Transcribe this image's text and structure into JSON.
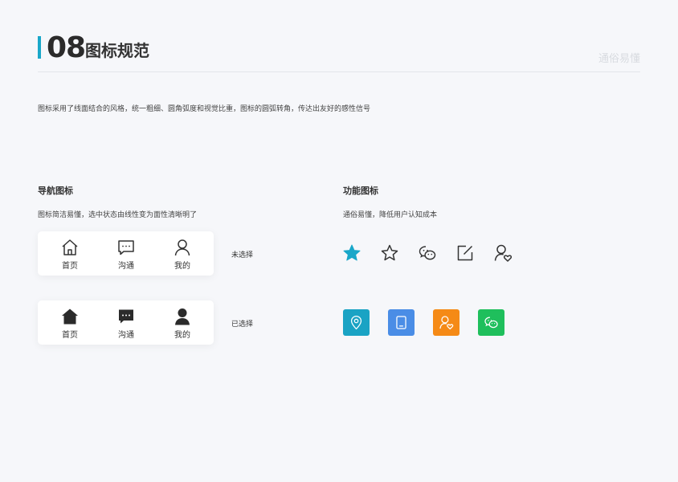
{
  "header": {
    "number": "08",
    "title": "图标规范",
    "motto": "通俗易懂",
    "accent_color": "#19a7c9"
  },
  "description": "图标采用了线面结合的风格，统一粗细、圆角弧度和视觉比重，图标的圆弧转角，传达出友好的感性信号",
  "nav_section": {
    "title": "导航图标",
    "subtitle": "图标简洁易懂，选中状态由线性变为面性清晰明了",
    "items": [
      {
        "label": "首页",
        "icon": "home-icon"
      },
      {
        "label": "沟通",
        "icon": "chat-icon"
      },
      {
        "label": "我的",
        "icon": "user-icon"
      }
    ],
    "unselected_label": "未选择",
    "selected_label": "已选择"
  },
  "func_section": {
    "title": "功能图标",
    "subtitle": "通俗易懂，降低用户认知成本",
    "outline_icons": [
      "star-filled-icon",
      "star-outline-icon",
      "wechat-icon",
      "edit-icon",
      "user-heart-icon"
    ],
    "tiles": [
      {
        "icon": "location-icon",
        "color": "#1aa3c4"
      },
      {
        "icon": "tablet-icon",
        "color": "#4a8de6"
      },
      {
        "icon": "user-heart-icon",
        "color": "#f58a16"
      },
      {
        "icon": "wechat-icon",
        "color": "#1fbf5c"
      }
    ]
  }
}
